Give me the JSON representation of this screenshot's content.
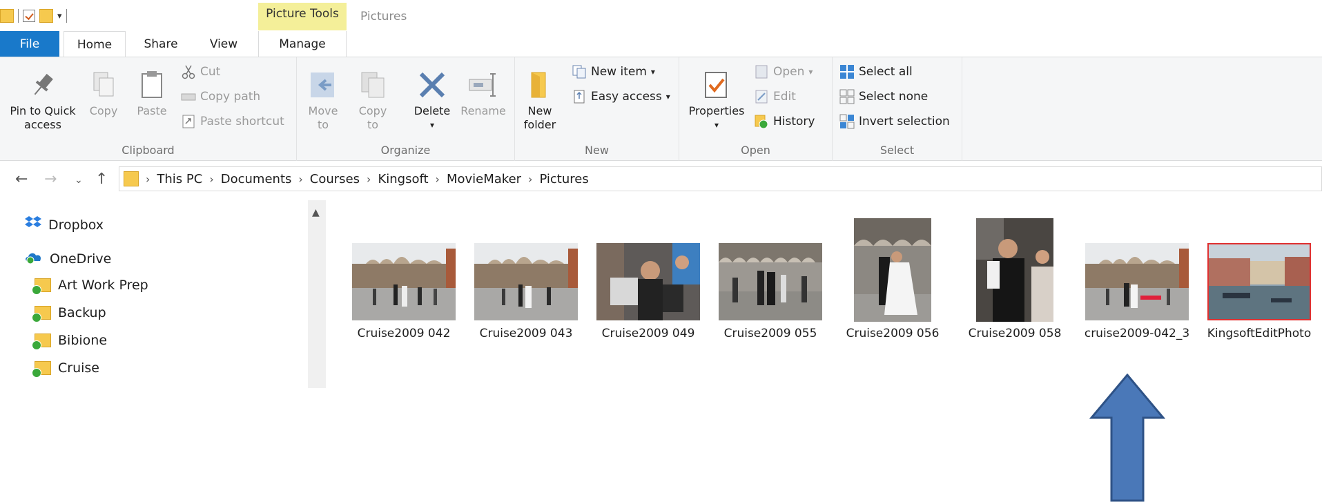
{
  "titlebar": {
    "context_tab_label": "Picture Tools",
    "window_title": "Pictures"
  },
  "tabs": {
    "file": "File",
    "home": "Home",
    "share": "Share",
    "view": "View",
    "manage": "Manage"
  },
  "ribbon": {
    "clipboard": {
      "label": "Clipboard",
      "pin_line1": "Pin to Quick",
      "pin_line2": "access",
      "copy": "Copy",
      "paste": "Paste",
      "cut": "Cut",
      "copy_path": "Copy path",
      "paste_shortcut": "Paste shortcut"
    },
    "organize": {
      "label": "Organize",
      "move_to": "Move",
      "move_to2": "to",
      "copy_to": "Copy",
      "copy_to2": "to",
      "delete": "Delete",
      "rename": "Rename"
    },
    "new": {
      "label": "New",
      "new_folder1": "New",
      "new_folder2": "folder",
      "new_item": "New item",
      "easy_access": "Easy access"
    },
    "open": {
      "label": "Open",
      "properties": "Properties",
      "open": "Open",
      "edit": "Edit",
      "history": "History"
    },
    "select": {
      "label": "Select",
      "select_all": "Select all",
      "select_none": "Select none",
      "invert_selection": "Invert selection"
    }
  },
  "address": {
    "crumbs": [
      "This PC",
      "Documents",
      "Courses",
      "Kingsoft",
      "MovieMaker",
      "Pictures"
    ]
  },
  "navpane": {
    "items": [
      {
        "label": "Dropbox",
        "icon": "dropbox-icon"
      },
      {
        "label": "OneDrive",
        "icon": "onedrive-icon"
      },
      {
        "label": "Art Work Prep",
        "icon": "folder-synced-icon"
      },
      {
        "label": "Backup",
        "icon": "folder-synced-icon"
      },
      {
        "label": "Bibione",
        "icon": "folder-synced-icon"
      },
      {
        "label": "Cruise",
        "icon": "folder-synced-icon"
      }
    ]
  },
  "files": [
    {
      "name": "Cruise2009 042"
    },
    {
      "name": "Cruise2009 043"
    },
    {
      "name": "Cruise2009 049"
    },
    {
      "name": "Cruise2009 055"
    },
    {
      "name": "Cruise2009 056"
    },
    {
      "name": "Cruise2009 058"
    },
    {
      "name": "cruise2009-042_3"
    },
    {
      "name": "KingsoftEditPhoto"
    }
  ],
  "colors": {
    "file_tab": "#1979ca",
    "context_tab": "#f4ef99",
    "arrow_fill": "#4a78b8",
    "arrow_stroke": "#2e5286",
    "selected_thumb_border": "#e03030"
  }
}
